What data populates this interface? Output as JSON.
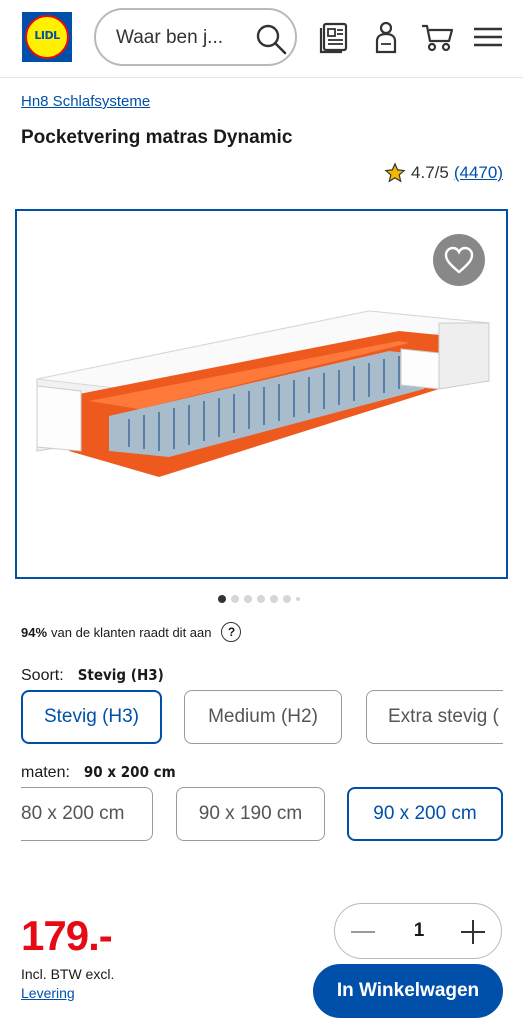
{
  "header": {
    "logo_text": "LIDL",
    "search_placeholder": "Waar ben j...",
    "icons": [
      "search-icon",
      "brochure-icon",
      "account-icon",
      "cart-icon",
      "menu-icon"
    ]
  },
  "breadcrumb": "Hn8 Schlafsysteme",
  "product": {
    "title": "Pocketvering matras Dynamic",
    "rating": "4.7/5",
    "review_count": "(4470)"
  },
  "gallery": {
    "dots_total": 7,
    "active_index": 0
  },
  "recommendation": {
    "percent": "94%",
    "text": "van de klanten raadt dit aan",
    "help": "?"
  },
  "variants": {
    "type_label": "Soort:",
    "type_value": "Stevig (H3)",
    "types": [
      "Stevig (H3)",
      "Medium (H2)",
      "Extra stevig ("
    ],
    "size_label": "maten:",
    "size_value": "90 x 200 cm",
    "sizes": [
      "80 x 200 cm",
      "90 x 190 cm",
      "90 x 200 cm"
    ]
  },
  "purchase": {
    "price": "179.-",
    "vat": "Incl. BTW excl.",
    "delivery": "Levering",
    "quantity": "1",
    "add_to_cart": "In Winkelwagen"
  },
  "colors": {
    "brand_blue": "#0050aa",
    "price_red": "#e60a14",
    "logo_yellow": "#fff000"
  }
}
